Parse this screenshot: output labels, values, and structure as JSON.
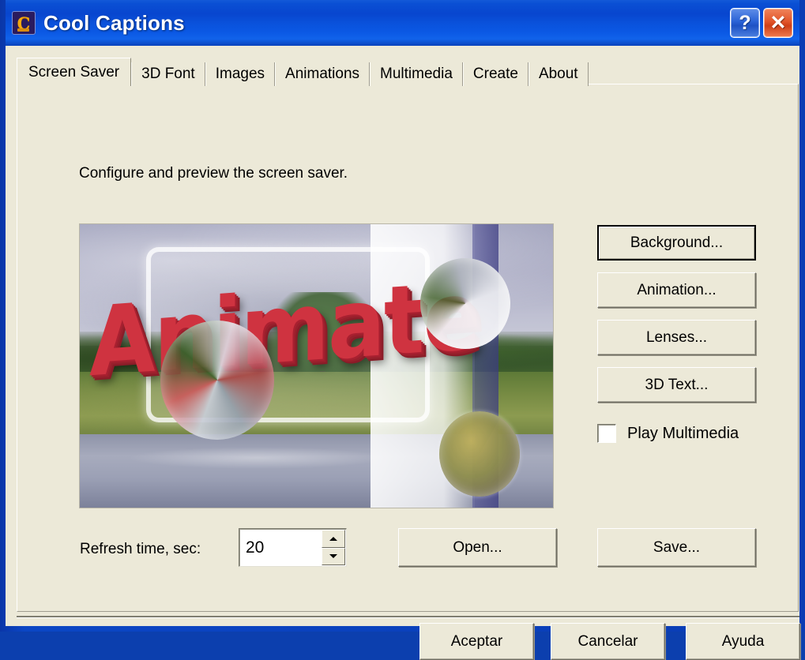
{
  "window": {
    "title": "Cool Captions",
    "icon": "app-c-icon",
    "help_button": "?",
    "close_button": "✕",
    "frame_color": "#0a3cb4",
    "titlebar_color": "#0a4fd4",
    "client_color": "#ece9d8"
  },
  "tabs": [
    {
      "label": "Screen Saver",
      "selected": true
    },
    {
      "label": "3D Font",
      "selected": false
    },
    {
      "label": "Images",
      "selected": false
    },
    {
      "label": "Animations",
      "selected": false
    },
    {
      "label": "Multimedia",
      "selected": false
    },
    {
      "label": "Create",
      "selected": false
    },
    {
      "label": "About",
      "selected": false
    }
  ],
  "panel": {
    "hint": "Configure and preview the screen saver.",
    "preview": {
      "caption_text": "Animate",
      "caption_color": "#cf3340",
      "description": "Landscape photo preview with 3D red caption text, glass frame and lens effects"
    },
    "side_buttons": [
      {
        "label": "Background...",
        "default": true
      },
      {
        "label": "Animation...",
        "default": false
      },
      {
        "label": "Lenses...",
        "default": false
      },
      {
        "label": "3D Text...",
        "default": false
      }
    ],
    "checkbox": {
      "label": "Play Multimedia",
      "checked": false
    },
    "refresh": {
      "label": "Refresh time, sec:",
      "value": "20",
      "spin_up": "▲",
      "spin_down": "▼"
    },
    "file_buttons": {
      "open": "Open...",
      "save": "Save..."
    }
  },
  "dialog_buttons": {
    "accept": "Aceptar",
    "cancel": "Cancelar",
    "help": "Ayuda"
  }
}
